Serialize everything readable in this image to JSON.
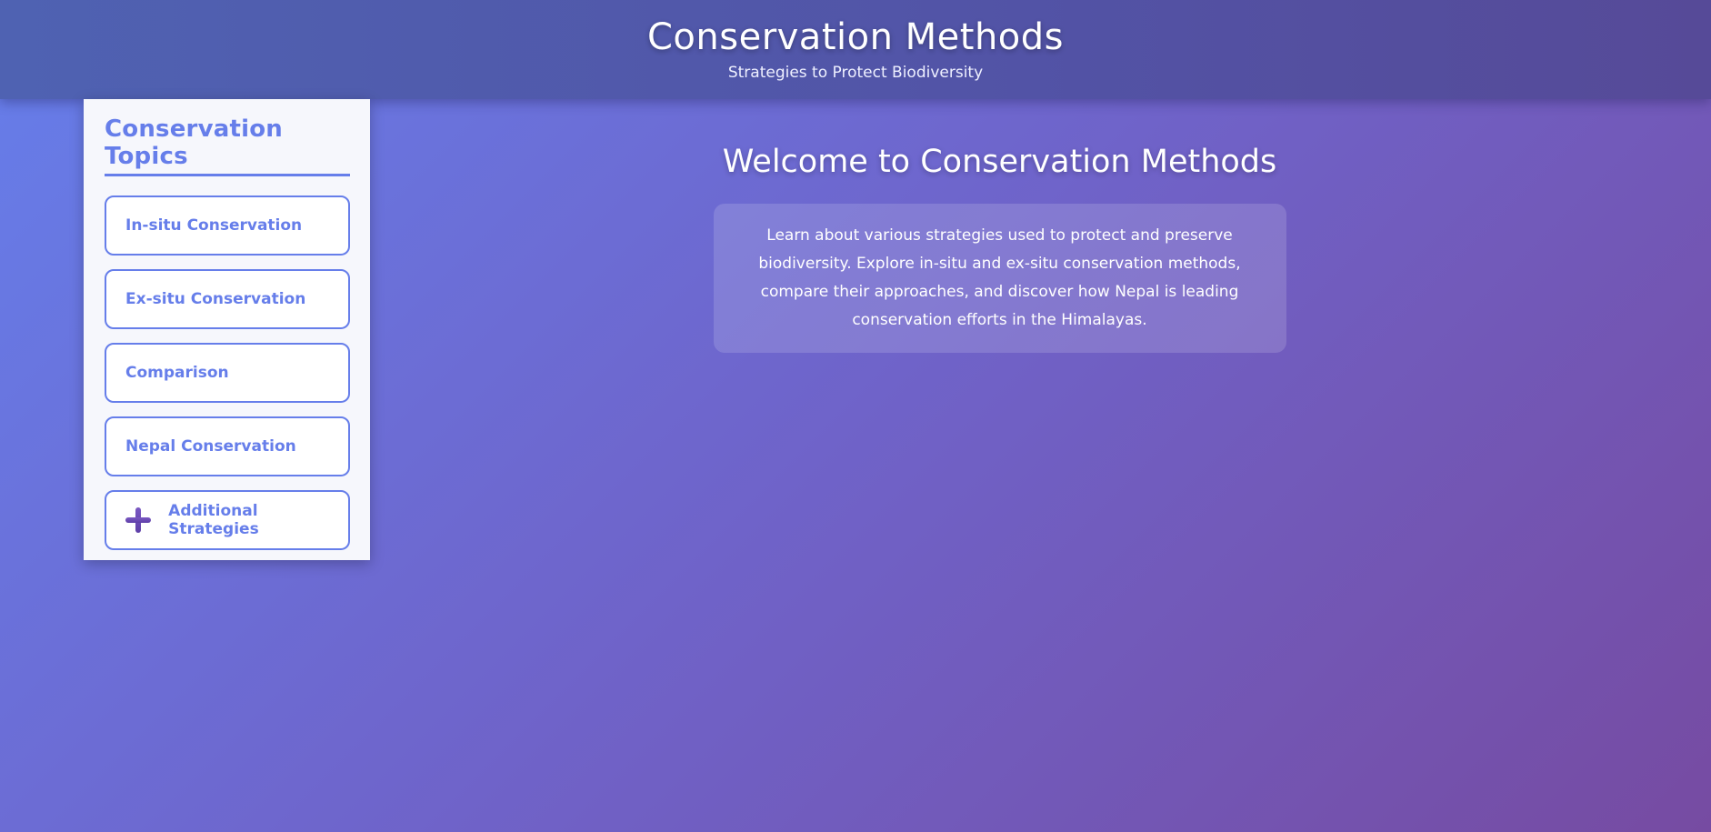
{
  "header": {
    "title": "Conservation Methods",
    "subtitle": "Strategies to Protect Biodiversity"
  },
  "sidebar": {
    "title": "Conservation Topics",
    "items": [
      {
        "label": "In-situ Conservation"
      },
      {
        "label": "Ex-situ Conservation"
      },
      {
        "label": "Comparison"
      },
      {
        "label": "Nepal Conservation"
      },
      {
        "label": "Additional Strategies",
        "icon": "plus-icon"
      }
    ]
  },
  "main": {
    "heading": "Welcome to Conservation Methods",
    "intro": "Learn about various strategies used to protect and preserve biodiversity. Explore in-situ and ex-situ conservation methods, compare their approaches, and discover how Nepal is leading conservation efforts in the Himalayas."
  },
  "colors": {
    "accent": "#667eea",
    "gradient_start": "#667eea",
    "gradient_end": "#764ba2"
  }
}
